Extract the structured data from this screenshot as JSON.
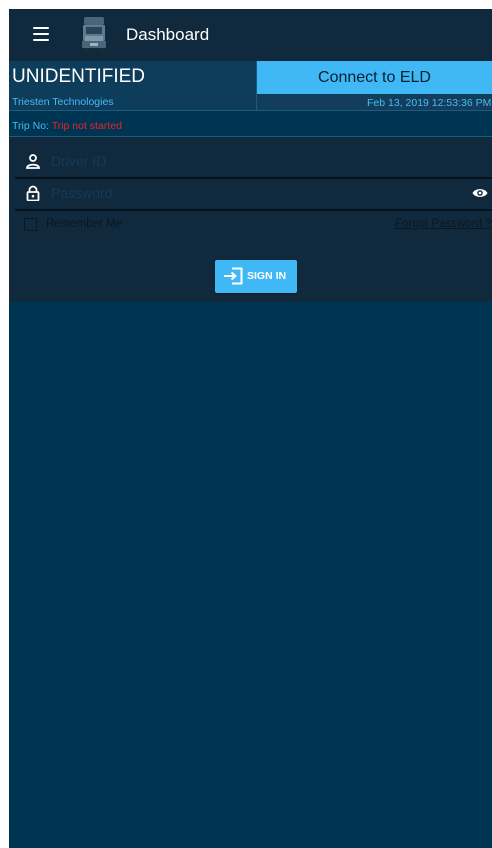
{
  "appbar": {
    "title": "Dashboard",
    "menu_icon": "hamburger-menu-icon",
    "logo_icon": "truck-icon"
  },
  "status": {
    "vehicle_name": "UNIDENTIFIED",
    "company": "Triesten Technologies",
    "connect_label": "Connect to ELD",
    "datetime": "Feb 13, 2019 12:53:36 PM",
    "trip_label": "Trip No:",
    "trip_value": "Trip not started"
  },
  "login": {
    "driver_id_placeholder": "Driver ID",
    "password_placeholder": "Password",
    "remember_label": "Remember Me",
    "remember_checked": false,
    "forgot_label": "Forgot Password ?",
    "signin_label": "SIGN IN"
  },
  "colors": {
    "background": "#003453",
    "appbar": "#10293d",
    "accent": "#41b8f6",
    "company_text": "#47bbf2",
    "error_text": "#e8262a"
  }
}
